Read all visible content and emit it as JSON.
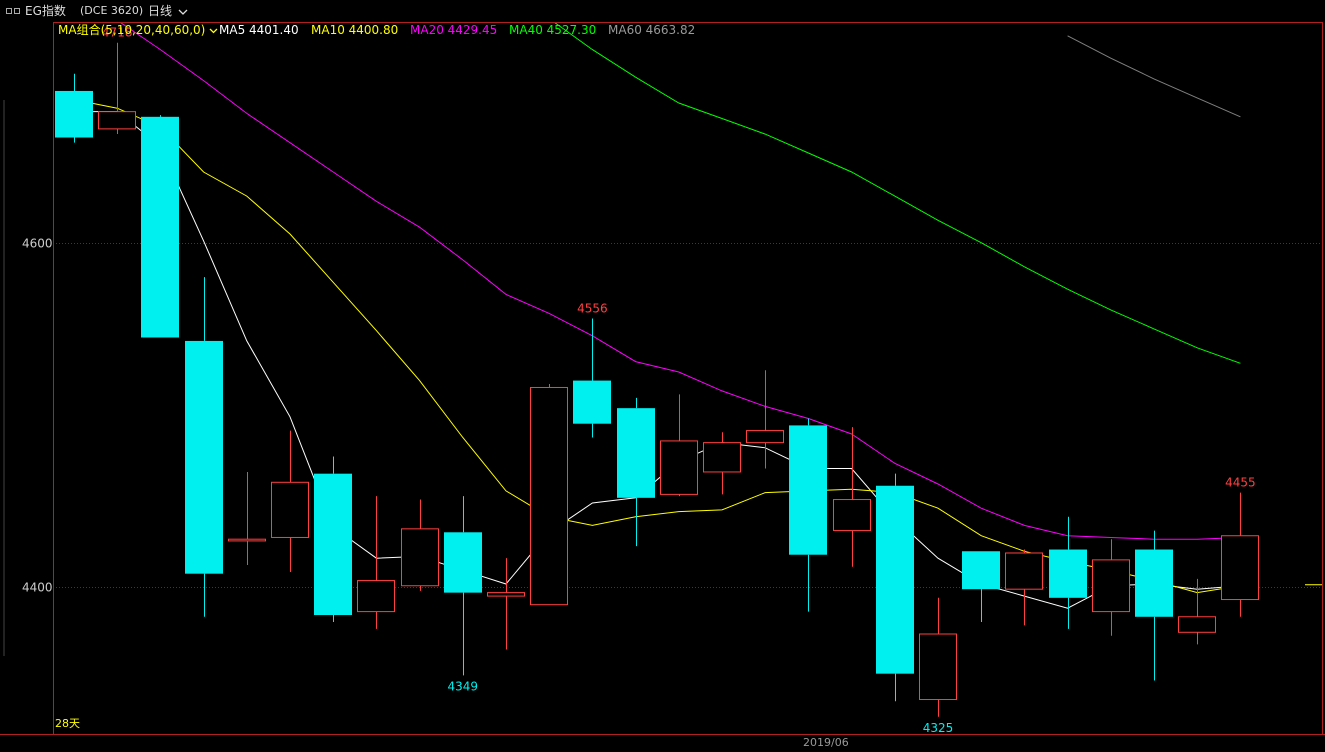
{
  "header": {
    "symbol_name": "EG指数",
    "symbol_code": "(DCE 3620)",
    "period": "日线",
    "period_dropdown_icon": "chevron-down-icon",
    "window_icon": "window-icon"
  },
  "legend": {
    "group_label": "MA组合(5,10,20,40,60,0)",
    "group_dropdown_icon": "chevron-down-icon",
    "items": [
      {
        "label": "MA5 4401.40",
        "color": "#ffffff"
      },
      {
        "label": "MA10 4400.80",
        "color": "#ffff00"
      },
      {
        "label": "MA20 4429.45",
        "color": "#ff00ff"
      },
      {
        "label": "MA40 4527.30",
        "color": "#00ff00"
      },
      {
        "label": "MA60 4663.82",
        "color": "#808080"
      }
    ]
  },
  "footer": {
    "days_label": "28天",
    "date_label": "2019/06"
  },
  "colors": {
    "up": "#ff4040",
    "down": "#00f0f0",
    "frame": "#b02020",
    "grid": "#8a1a1a",
    "axis_text": "#cccccc"
  },
  "chart_data": {
    "type": "candlestick",
    "ylim": [
      4315,
      4728
    ],
    "yticks": [
      {
        "value": 4600,
        "label": "4600"
      },
      {
        "value": 4400,
        "label": "4400"
      }
    ],
    "candles": [
      {
        "o": 4688,
        "h": 4698,
        "l": 4658,
        "c": 4661
      },
      {
        "o": 4666,
        "h": 4716,
        "l": 4663,
        "c": 4676
      },
      {
        "o": 4673,
        "h": 4674,
        "l": 4545,
        "c": 4545
      },
      {
        "o": 4543,
        "h": 4580,
        "l": 4383,
        "c": 4408
      },
      {
        "o": 4427,
        "h": 4467,
        "l": 4413,
        "c": 4428
      },
      {
        "o": 4429,
        "h": 4491,
        "l": 4409,
        "c": 4461
      },
      {
        "o": 4466,
        "h": 4476,
        "l": 4380,
        "c": 4384
      },
      {
        "o": 4386,
        "h": 4453,
        "l": 4376,
        "c": 4404
      },
      {
        "o": 4401,
        "h": 4451,
        "l": 4398,
        "c": 4434
      },
      {
        "o": 4432,
        "h": 4453,
        "l": 4349,
        "c": 4397
      },
      {
        "o": 4395,
        "h": 4417,
        "l": 4364,
        "c": 4397
      },
      {
        "o": 4390,
        "h": 4518,
        "l": 4390,
        "c": 4516
      },
      {
        "o": 4520,
        "h": 4556,
        "l": 4487,
        "c": 4495
      },
      {
        "o": 4504,
        "h": 4510,
        "l": 4424,
        "c": 4452
      },
      {
        "o": 4454,
        "h": 4512,
        "l": 4453,
        "c": 4485
      },
      {
        "o": 4467,
        "h": 4490,
        "l": 4454,
        "c": 4484
      },
      {
        "o": 4484,
        "h": 4526,
        "l": 4469,
        "c": 4491
      },
      {
        "o": 4494,
        "h": 4498,
        "l": 4386,
        "c": 4419
      },
      {
        "o": 4433,
        "h": 4493,
        "l": 4412,
        "c": 4451
      },
      {
        "o": 4459,
        "h": 4466,
        "l": 4334,
        "c": 4350
      },
      {
        "o": 4335,
        "h": 4394,
        "l": 4325,
        "c": 4373
      },
      {
        "o": 4421,
        "h": 4421,
        "l": 4380,
        "c": 4399
      },
      {
        "o": 4399,
        "h": 4422,
        "l": 4378,
        "c": 4420
      },
      {
        "o": 4422,
        "h": 4441,
        "l": 4376,
        "c": 4394
      },
      {
        "o": 4386,
        "h": 4428,
        "l": 4372,
        "c": 4416
      },
      {
        "o": 4422,
        "h": 4433,
        "l": 4346,
        "c": 4383
      },
      {
        "o": 4374,
        "h": 4405,
        "l": 4367,
        "c": 4383
      },
      {
        "o": 4393,
        "h": 4455,
        "l": 4383,
        "c": 4430
      }
    ],
    "series": [
      {
        "name": "MA5",
        "color": "#ffffff",
        "values": [
          4676,
          4676,
          4656,
          4601,
          4543,
          4499,
          4435,
          4417,
          4418,
          4410,
          4402,
          4432,
          4449,
          4452,
          4473,
          4484,
          4481,
          4469,
          4469,
          4440,
          4417,
          4402,
          4395,
          4388,
          4401,
          4402,
          4399,
          4401
        ]
      },
      {
        "name": "MA10",
        "color": "#ffff00",
        "values": [
          4683,
          4678,
          4667,
          4641,
          4627,
          4605,
          4577,
          4549,
          4520,
          4487,
          4456,
          4441,
          4436,
          4441,
          4444,
          4445,
          4455,
          4456,
          4457,
          4455,
          4446,
          4430,
          4421,
          4415,
          4410,
          4404,
          4397,
          4401
        ]
      },
      {
        "name": "MA20",
        "color": "#ff00ff",
        "values": [
          4735,
          4729,
          4712,
          4694,
          4675,
          4658,
          4641,
          4624,
          4609,
          4590,
          4570,
          4559,
          4546,
          4531,
          4525,
          4514,
          4505,
          4498,
          4489,
          4472,
          4460,
          4446,
          4436,
          4430,
          4429,
          4428,
          4428,
          4429
        ]
      },
      {
        "name": "MA40",
        "color": "#00ff00",
        "values": [
          null,
          null,
          null,
          null,
          null,
          null,
          null,
          null,
          null,
          null,
          null,
          4730,
          4712,
          4696,
          4681,
          4672,
          4663,
          4652,
          4641,
          4627,
          4613,
          4600,
          4586,
          4573,
          4561,
          4550,
          4539,
          4530
        ]
      },
      {
        "name": "MA60",
        "color": "#808080",
        "values": [
          null,
          null,
          null,
          null,
          null,
          null,
          null,
          null,
          null,
          null,
          null,
          null,
          null,
          null,
          null,
          null,
          null,
          null,
          null,
          null,
          null,
          null,
          null,
          4720,
          4707,
          4695,
          4684,
          4673
        ]
      }
    ],
    "annotations": [
      {
        "label": "4718",
        "index": 1,
        "value": 4716,
        "kind": "high"
      },
      {
        "label": "4556",
        "index": 12,
        "value": 4556,
        "kind": "high"
      },
      {
        "label": "4349",
        "index": 9,
        "value": 4349,
        "kind": "low"
      },
      {
        "label": "4325",
        "index": 20,
        "value": 4325,
        "kind": "low"
      },
      {
        "label": "4455",
        "index": 27,
        "value": 4455,
        "kind": "high"
      }
    ]
  }
}
